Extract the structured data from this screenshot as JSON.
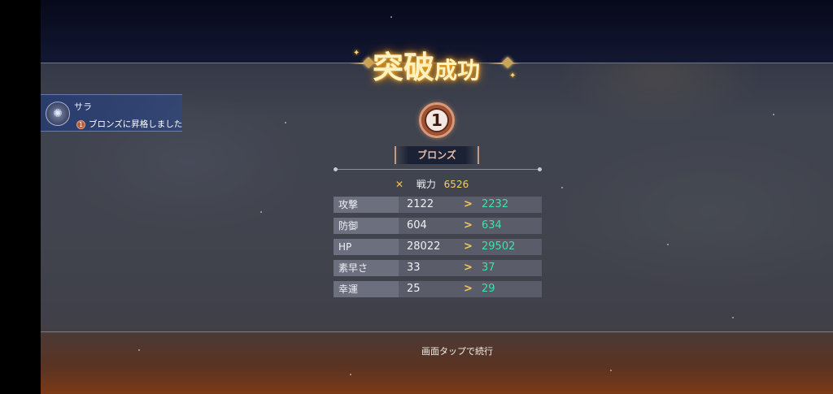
{
  "title": {
    "main": "突破",
    "sub": "成功"
  },
  "notification": {
    "character_name": "サラ",
    "rank_badge": "①",
    "message": "ブロンズに昇格しました"
  },
  "rank": {
    "number": "1",
    "name": "ブロンズ"
  },
  "power": {
    "icon": "crossed-swords-icon",
    "label": "戦力",
    "value": "6526"
  },
  "stats": [
    {
      "label": "攻撃",
      "old": "2122",
      "new": "2232"
    },
    {
      "label": "防御",
      "old": "604",
      "new": "634"
    },
    {
      "label": "HP",
      "old": "28022",
      "new": "29502"
    },
    {
      "label": "素早さ",
      "old": "33",
      "new": "37"
    },
    {
      "label": "幸運",
      "old": "25",
      "new": "29"
    }
  ],
  "continue_text": "画面タップで続行",
  "colors": {
    "increase": "#3fe0a6",
    "power_value": "#f2cf6a",
    "arrow": "#f2c85a",
    "rank_bronze": "#c97b5a"
  }
}
